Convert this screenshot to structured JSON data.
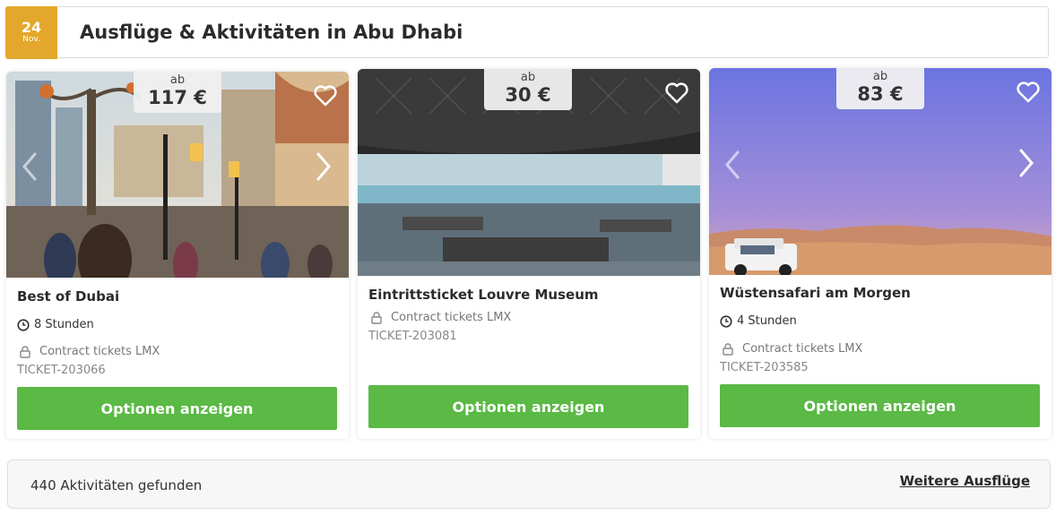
{
  "header": {
    "date_day": "24",
    "date_month": "Nov.",
    "title": "Ausflüge & Aktivitäten in Abu Dhabi"
  },
  "cards": [
    {
      "price_prefix": "ab",
      "price": "117 €",
      "title": "Best of Dubai",
      "duration": "8 Stunden",
      "supplier": "Contract tickets LMX",
      "ticket_id": "TICKET-203066",
      "cta_label": "Optionen anzeigen"
    },
    {
      "price_prefix": "ab",
      "price": "30 €",
      "title": "Eintrittsticket Louvre Museum",
      "supplier": "Contract tickets LMX",
      "ticket_id": "TICKET-203081",
      "cta_label": "Optionen anzeigen"
    },
    {
      "price_prefix": "ab",
      "price": "83 €",
      "title": "Wüstensafari am Morgen",
      "duration": "4 Stunden",
      "supplier": "Contract tickets LMX",
      "ticket_id": "TICKET-203585",
      "cta_label": "Optionen anzeigen"
    }
  ],
  "footer": {
    "count_text": "440 Aktivitäten gefunden",
    "more_link": "Weitere Ausflüge"
  },
  "colors": {
    "accent_date": "#e3a82b",
    "cta_green": "#5bb945"
  },
  "icons": [
    "heart-icon",
    "chevron-left-icon",
    "chevron-right-icon",
    "clock-icon",
    "lock-icon"
  ]
}
